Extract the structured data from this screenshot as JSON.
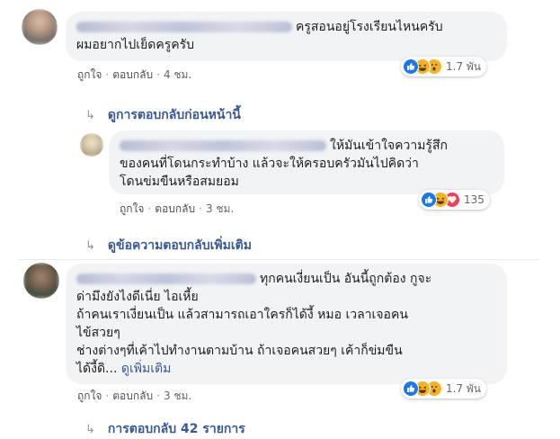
{
  "comments": [
    {
      "text_lines": [
        "ครูสอนอยู่โรงเรียนไหนครับ",
        "ผมอยากไปเย็ดครูครับ"
      ],
      "actions": {
        "like": "ถูกใจ",
        "reply": "ตอบกลับ",
        "time": "4 ชม."
      },
      "reactions": {
        "icons": [
          "like-icon",
          "haha-icon",
          "wow-icon"
        ],
        "count": "1.7 พัน"
      }
    },
    {
      "text_lines": [
        "ให้มันเข้าใจความรู้สึก",
        "ของคนที่โดนกระทำบ้าง แล้วจะให้ครอบครัวมันไปคิดว่า",
        "โดนข่มขืนหรือสมยอม"
      ],
      "actions": {
        "like": "ถูกใจ",
        "reply": "ตอบกลับ",
        "time": "3 ชม."
      },
      "reactions": {
        "icons": [
          "like-icon",
          "haha-icon",
          "love-icon"
        ],
        "count": "135"
      }
    },
    {
      "text_lines": [
        "ทุกคนเงี่ยนเป็น อันนี้ถูกต้อง กูจะ",
        "ด่ามึงยังไงดีเนี่ย ไอเหี้ย",
        "ถ้าคนเราเงี่ยนเป็น แล้วสามารถเอาใครก็ได้งี้ หมอ เวลาเจอคน",
        "ไข้สวยๆ",
        "ช่างต่างๆที่เค้าไปทำงานตามบ้าน ถ้าเจอคนสวยๆ เค้าก็ข่มขืน",
        "ได้งี้ดิ..."
      ],
      "see_more": "ดูเพิ่มเติม",
      "actions": {
        "like": "ถูกใจ",
        "reply": "ตอบกลับ",
        "time": "3 ชม."
      },
      "reactions": {
        "icons": [
          "like-icon",
          "haha-icon",
          "wow-icon"
        ],
        "count": "1.7 พัน"
      }
    }
  ],
  "reply_links": {
    "previous": "ดูการตอบกลับก่อนหน้านี้",
    "more_replies": "ดูข้อความตอบกลับเพิ่มเติม",
    "reply_count": "การตอบกลับ 42 รายการ"
  },
  "colors": {
    "bubble": "#f2f3f5",
    "link": "#385898",
    "meta": "#606770",
    "like": "#1877f2",
    "haha": "#f7b125",
    "love": "#f33e58"
  }
}
